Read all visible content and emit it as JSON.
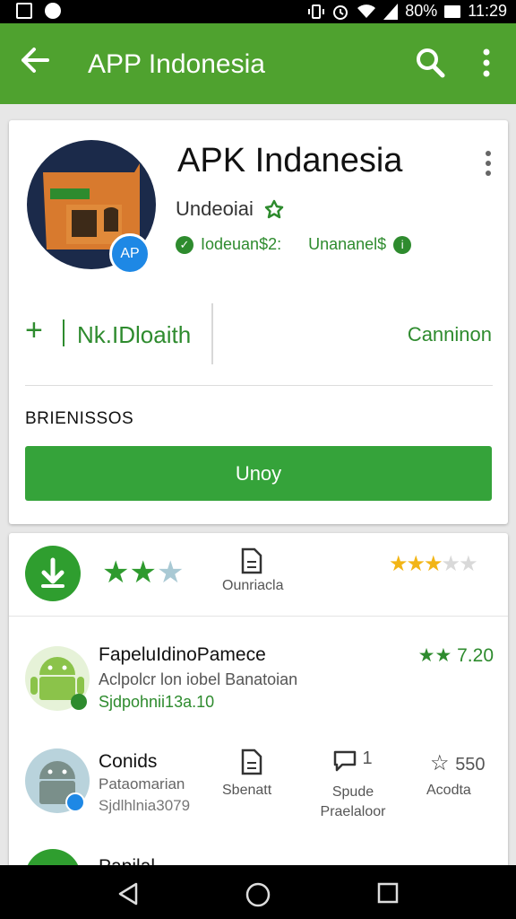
{
  "status_bar": {
    "battery": "80%",
    "time": "11:29"
  },
  "app_bar": {
    "title": "APP Indonesia"
  },
  "app_header": {
    "title": "APK Indanesia",
    "badge_text": "AP",
    "developer": "Undeoiai",
    "meta_left": "Iodeuan$2:",
    "meta_right": "Unananel$"
  },
  "action_row": {
    "install_label": "Nk.IDloaith",
    "right_label": "Canninon"
  },
  "section_label": "BRIENISSOS",
  "main_button_label": "Unoy",
  "rating_row": {
    "doc_label": "Ounriacla"
  },
  "list": {
    "row1": {
      "title": "FapeluIdinoPamece",
      "subtitle": "Aclpolcr lon iobel Banatoian",
      "link": "Sjdpohnii13a.10",
      "rating": "7.20"
    },
    "row2": {
      "title": "Conids",
      "subtitle": "Pataomarian",
      "link": "Sjdlhlnia3079",
      "col1_label": "Sbenatt",
      "col2_count": "1",
      "col2_label": "Spude Praelaloor",
      "col3_count": "550",
      "col3_label": "Acodta"
    },
    "row3": {
      "title": "Papilal"
    }
  },
  "colors": {
    "primary": "#4fa22f",
    "accent": "#2e8b2e",
    "star_yellow": "#f2b516"
  }
}
